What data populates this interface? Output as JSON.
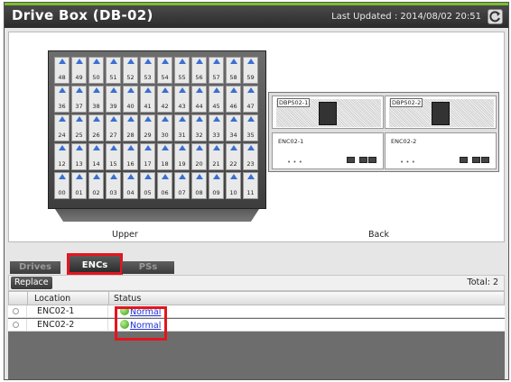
{
  "header": {
    "title": "Drive Box (DB-02)",
    "last_updated": "Last Updated : 2014/08/02 20:51"
  },
  "view": {
    "upper_label": "Upper",
    "back_label": "Back",
    "drive_slot_rows": [
      [
        "48",
        "49",
        "50",
        "51",
        "52",
        "53",
        "54",
        "55",
        "56",
        "57",
        "58",
        "59"
      ],
      [
        "36",
        "37",
        "38",
        "39",
        "40",
        "41",
        "42",
        "43",
        "44",
        "45",
        "46",
        "47"
      ],
      [
        "24",
        "25",
        "26",
        "27",
        "28",
        "29",
        "30",
        "31",
        "32",
        "33",
        "34",
        "35"
      ],
      [
        "12",
        "13",
        "14",
        "15",
        "16",
        "17",
        "18",
        "19",
        "20",
        "21",
        "22",
        "23"
      ],
      [
        "00",
        "01",
        "02",
        "03",
        "04",
        "05",
        "06",
        "07",
        "08",
        "09",
        "10",
        "11"
      ]
    ],
    "psus": [
      "DBPS02-1",
      "DBPS02-2"
    ],
    "encs": [
      "ENC02-1",
      "ENC02-2"
    ]
  },
  "tabs": {
    "drives": "Drives",
    "encs": "ENCs",
    "pss": "PSs",
    "active": "ENCs"
  },
  "toolbar": {
    "replace_label": "Replace",
    "total": "Total: 2"
  },
  "table": {
    "columns": [
      "Location",
      "Status"
    ],
    "rows": [
      {
        "location": "ENC02-1",
        "status": "Normal"
      },
      {
        "location": "ENC02-2",
        "status": "Normal"
      }
    ]
  },
  "colors": {
    "accent": "#7bbf2a",
    "highlight": "#e5151d",
    "status_ok": "#2f9d17",
    "link": "#1e2fd6"
  },
  "icons": {
    "refresh": "refresh-icon",
    "status": "status-normal-icon"
  }
}
